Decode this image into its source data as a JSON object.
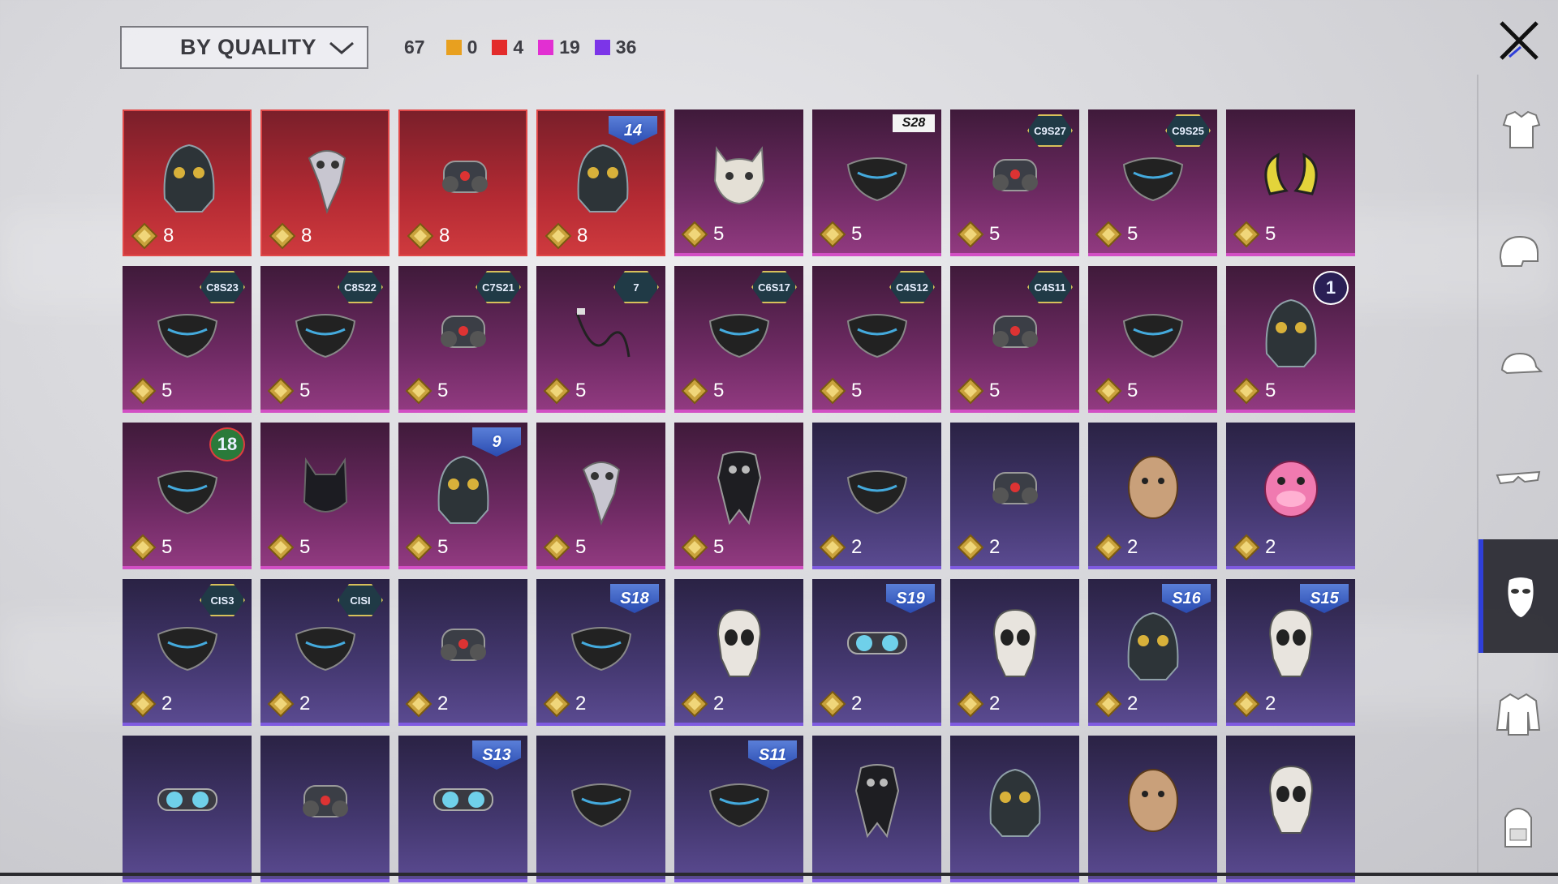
{
  "sort": {
    "label": "BY QUALITY"
  },
  "counts": {
    "total": "67",
    "tiers": [
      {
        "color": "#e8a01f",
        "value": "0"
      },
      {
        "color": "#e32b2b",
        "value": "4"
      },
      {
        "color": "#e22fd2",
        "value": "19"
      },
      {
        "color": "#7c35e8",
        "value": "36"
      }
    ]
  },
  "colors": {
    "accent": "#2f3fd9",
    "red_tier": "#e04848",
    "magenta_tier": "#d24fc4",
    "purple_tier": "#7f5be0"
  },
  "sidebar": {
    "tabs": [
      {
        "name": "outfit-icon",
        "active": false
      },
      {
        "name": "helmet-icon",
        "active": false
      },
      {
        "name": "cap-icon",
        "active": false
      },
      {
        "name": "glasses-icon",
        "active": false
      },
      {
        "name": "mask-icon",
        "active": true
      },
      {
        "name": "jacket-icon",
        "active": false
      },
      {
        "name": "backpack-icon",
        "active": false
      }
    ]
  },
  "items": [
    {
      "tier": "red",
      "price": "8",
      "badge": "",
      "badge_type": "",
      "art": "helmet"
    },
    {
      "tier": "red",
      "price": "8",
      "badge": "",
      "badge_type": "",
      "art": "beak"
    },
    {
      "tier": "red",
      "price": "8",
      "badge": "",
      "badge_type": "",
      "art": "respirator"
    },
    {
      "tier": "red",
      "price": "8",
      "badge": "14",
      "badge_type": "shield",
      "art": "helmet"
    },
    {
      "tier": "magenta",
      "price": "5",
      "badge": "",
      "badge_type": "",
      "art": "cat"
    },
    {
      "tier": "magenta",
      "price": "5",
      "badge": "S28",
      "badge_type": "plain",
      "art": "cloth"
    },
    {
      "tier": "magenta",
      "price": "5",
      "badge": "C9S27",
      "badge_type": "hex",
      "art": "respirator"
    },
    {
      "tier": "magenta",
      "price": "5",
      "badge": "C9S25",
      "badge_type": "hex",
      "art": "cloth"
    },
    {
      "tier": "magenta",
      "price": "5",
      "badge": "",
      "badge_type": "",
      "art": "horns"
    },
    {
      "tier": "magenta",
      "price": "5",
      "badge": "C8S23",
      "badge_type": "hex",
      "art": "cloth"
    },
    {
      "tier": "magenta",
      "price": "5",
      "badge": "C8S22",
      "badge_type": "hex",
      "art": "cloth"
    },
    {
      "tier": "magenta",
      "price": "5",
      "badge": "C7S21",
      "badge_type": "hex",
      "art": "respirator"
    },
    {
      "tier": "magenta",
      "price": "5",
      "badge": "7",
      "badge_type": "hex",
      "art": "wire"
    },
    {
      "tier": "magenta",
      "price": "5",
      "badge": "C6S17",
      "badge_type": "hex",
      "art": "cloth"
    },
    {
      "tier": "magenta",
      "price": "5",
      "badge": "C4S12",
      "badge_type": "hex",
      "art": "cloth"
    },
    {
      "tier": "magenta",
      "price": "5",
      "badge": "C4S11",
      "badge_type": "hex",
      "art": "respirator"
    },
    {
      "tier": "magenta",
      "price": "5",
      "badge": "",
      "badge_type": "",
      "art": "cloth"
    },
    {
      "tier": "magenta",
      "price": "5",
      "badge": "1",
      "badge_type": "num",
      "art": "helmet"
    },
    {
      "tier": "magenta",
      "price": "5",
      "badge": "18",
      "badge_type": "numred",
      "art": "cloth"
    },
    {
      "tier": "magenta",
      "price": "5",
      "badge": "",
      "badge_type": "",
      "art": "catmask"
    },
    {
      "tier": "magenta",
      "price": "5",
      "badge": "9",
      "badge_type": "shield",
      "art": "helmet"
    },
    {
      "tier": "magenta",
      "price": "5",
      "badge": "",
      "badge_type": "",
      "art": "beak"
    },
    {
      "tier": "magenta",
      "price": "5",
      "badge": "",
      "badge_type": "",
      "art": "bandana"
    },
    {
      "tier": "purple",
      "price": "2",
      "badge": "",
      "badge_type": "",
      "art": "cloth"
    },
    {
      "tier": "purple",
      "price": "2",
      "badge": "",
      "badge_type": "",
      "art": "respirator"
    },
    {
      "tier": "purple",
      "price": "2",
      "badge": "",
      "badge_type": "",
      "art": "face"
    },
    {
      "tier": "purple",
      "price": "2",
      "badge": "",
      "badge_type": "",
      "art": "pinkface"
    },
    {
      "tier": "purple",
      "price": "2",
      "badge": "CIS3",
      "badge_type": "hex",
      "art": "cloth"
    },
    {
      "tier": "purple",
      "price": "2",
      "badge": "CISI",
      "badge_type": "hex",
      "art": "cloth"
    },
    {
      "tier": "purple",
      "price": "2",
      "badge": "",
      "badge_type": "",
      "art": "respirator"
    },
    {
      "tier": "purple",
      "price": "2",
      "badge": "S18",
      "badge_type": "shield",
      "art": "cloth"
    },
    {
      "tier": "purple",
      "price": "2",
      "badge": "",
      "badge_type": "",
      "art": "skull"
    },
    {
      "tier": "purple",
      "price": "2",
      "badge": "S19",
      "badge_type": "shield",
      "art": "goggles"
    },
    {
      "tier": "purple",
      "price": "2",
      "badge": "",
      "badge_type": "",
      "art": "skull"
    },
    {
      "tier": "purple",
      "price": "2",
      "badge": "S16",
      "badge_type": "shield",
      "art": "helmet"
    },
    {
      "tier": "purple",
      "price": "2",
      "badge": "S15",
      "badge_type": "shield",
      "art": "skull"
    },
    {
      "tier": "purple",
      "price": "",
      "badge": "",
      "badge_type": "",
      "art": "goggles"
    },
    {
      "tier": "purple",
      "price": "",
      "badge": "",
      "badge_type": "",
      "art": "respirator"
    },
    {
      "tier": "purple",
      "price": "",
      "badge": "S13",
      "badge_type": "shield",
      "art": "goggles"
    },
    {
      "tier": "purple",
      "price": "",
      "badge": "",
      "badge_type": "",
      "art": "cloth"
    },
    {
      "tier": "purple",
      "price": "",
      "badge": "S11",
      "badge_type": "shield",
      "art": "cloth"
    },
    {
      "tier": "purple",
      "price": "",
      "badge": "",
      "badge_type": "",
      "art": "bandana"
    },
    {
      "tier": "purple",
      "price": "",
      "badge": "",
      "badge_type": "",
      "art": "helmet"
    },
    {
      "tier": "purple",
      "price": "",
      "badge": "",
      "badge_type": "",
      "art": "face"
    },
    {
      "tier": "purple",
      "price": "",
      "badge": "",
      "badge_type": "",
      "art": "skull"
    }
  ]
}
